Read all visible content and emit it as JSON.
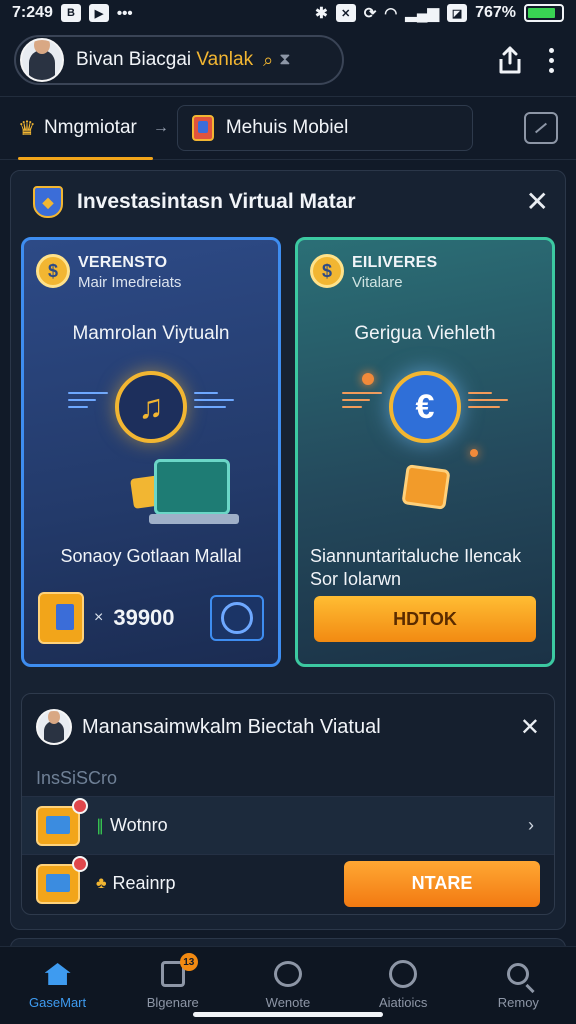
{
  "status_bar": {
    "time": "7:249",
    "battery_text": "767%",
    "battery_level": 0.85,
    "colors": {
      "battery": "#39d353"
    }
  },
  "header": {
    "user_name": "Bivan Biacgai",
    "user_name_accent": "Vanlak",
    "icons": [
      "avatar",
      "search-icon",
      "hourglass-icon",
      "share-icon",
      "more-vert-icon"
    ]
  },
  "tabs": {
    "active_label": "Nmgmiotar",
    "arrow": "→",
    "secondary_label": "Mehuis Mobiel"
  },
  "panel": {
    "title": "Investasintasn Virtual Matar",
    "close": "✕",
    "cards": [
      {
        "kicker": "VERENSTO",
        "kicker_sub": "Mair Imedreiats",
        "title": "Mamrolan Viytualn",
        "caption": "Sonaoy Gotlaan Mallal",
        "price_prefix": "×",
        "price": "39900",
        "accent": "#3e8df0"
      },
      {
        "kicker": "EILIVERES",
        "kicker_sub": "Vitalare",
        "title": "Gerigua Viehleth",
        "caption": "Siannuntaritaluche Ilencak Sor Iolarwn",
        "button_label": "HDTOK",
        "accent": "#3cc9a1"
      }
    ]
  },
  "section2": {
    "title": "Manansaimwkalm Biectah Viatual",
    "close": "✕",
    "label": "InsSiSCro",
    "rows": [
      {
        "glyph": "∥",
        "text": "Wotnro",
        "chevron": "›"
      },
      {
        "glyph": "♣",
        "text": "Reainrp",
        "button_label": "NTARE"
      }
    ]
  },
  "bottom_nav": {
    "items": [
      {
        "label": "GaseMart",
        "active": true
      },
      {
        "label": "Blgenare",
        "badge": "13"
      },
      {
        "label": "Wenote"
      },
      {
        "label": "Aiatioics"
      },
      {
        "label": "Remoy"
      }
    ]
  },
  "colors": {
    "background": "#111a28",
    "accent_gold": "#f2b632",
    "accent_orange": "#f28a12",
    "active_blue": "#3e9bf0"
  }
}
